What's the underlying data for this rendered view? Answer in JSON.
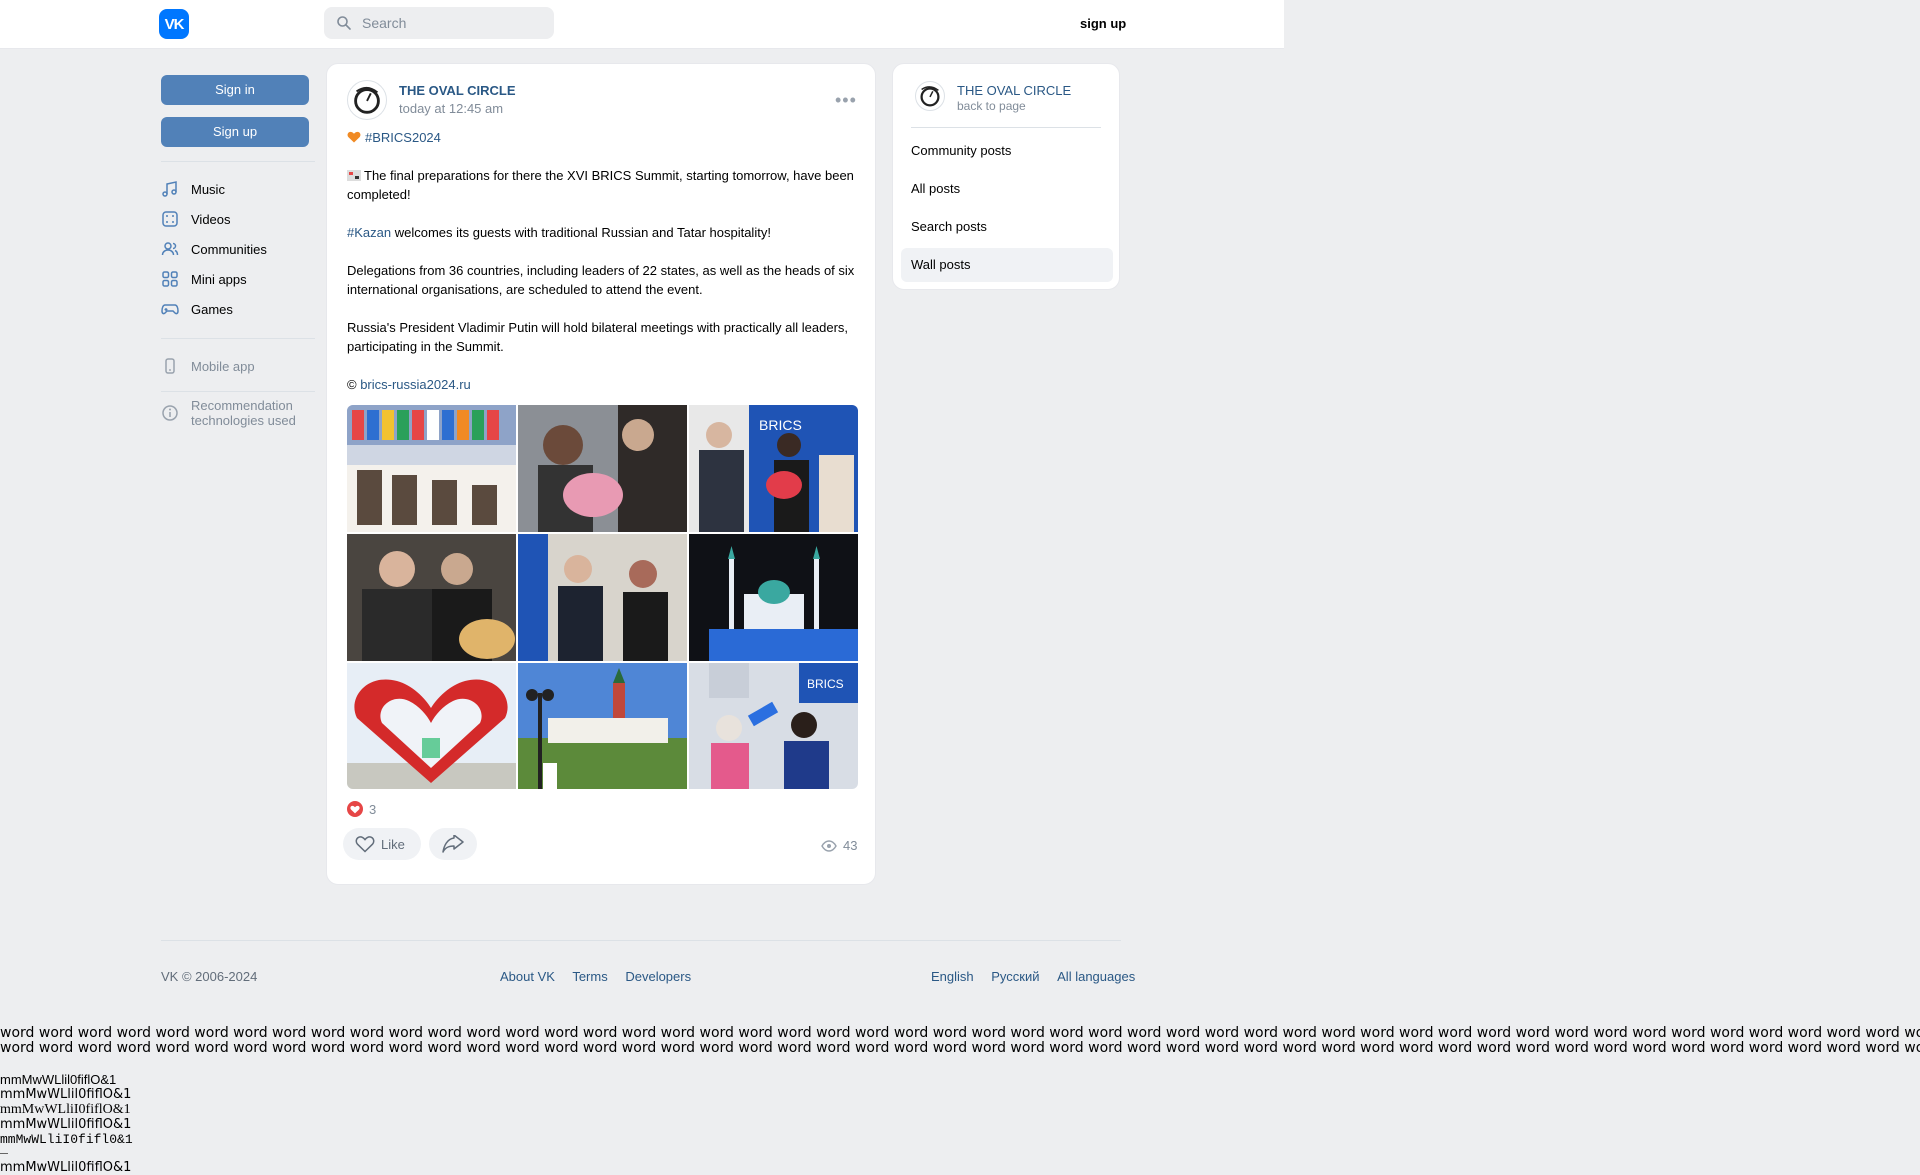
{
  "header": {
    "logo_text": "VK",
    "search_placeholder": "Search",
    "signup_label": "sign up"
  },
  "sidebar": {
    "signin_label": "Sign in",
    "signup_label": "Sign up",
    "items": [
      {
        "label": "Music",
        "icon": "music-icon"
      },
      {
        "label": "Videos",
        "icon": "video-icon"
      },
      {
        "label": "Communities",
        "icon": "communities-icon"
      },
      {
        "label": "Mini apps",
        "icon": "apps-icon"
      },
      {
        "label": "Games",
        "icon": "gamepad-icon"
      }
    ],
    "mobile_app": "Mobile app",
    "recommendation_line1": "Recommendation",
    "recommendation_line2": "technologies used"
  },
  "post": {
    "author": "THE OVAL CIRCLE",
    "date": "today at 12:45 am",
    "hashtag": "#BRICS2024",
    "p1": "The final preparations for there the XVI BRICS Summit, starting tomorrow, have been completed!",
    "kazan_tag": "#Kazan",
    "p2_rest": " welcomes its guests with traditional Russian and Tatar hospitality!",
    "p3": "Delegations from 36 countries, including leaders of 22 states, as well as the heads of six international organisations, are scheduled to attend the event.",
    "p4": "Russia's President Vladimir Putin will hold bilateral meetings with practically all leaders, participating in the Summit.",
    "source_prefix": "© ",
    "source_link": "brics-russia2024.ru",
    "reactions_count": "3",
    "like_label": "Like",
    "views_count": "43"
  },
  "right_panel": {
    "name": "THE OVAL CIRCLE",
    "back": "back to page",
    "items": [
      "Community posts",
      "All posts",
      "Search posts",
      "Wall posts"
    ],
    "active_index": 3
  },
  "footer": {
    "copyright": "VK © 2006-2024",
    "links": [
      "About VK",
      "Terms",
      "Developers"
    ],
    "languages": [
      "English",
      "Русский",
      "All languages"
    ]
  },
  "probe": {
    "words_line1": "word word word word word word word word word word word word word word word word word word word word word word word word word word word word word word word word word word word word word word word word word word word word word word word word word word word word word word word word word word word word word word word word word",
    "words_line2": "word word word word word word word word word word word word word word word word word word word word word word word word word word word word word word word word word word word word word word word word word word word word word word word word word word word word word word word word word word word word word word word word word",
    "lines": [
      "mmMwWLlil0fiflO&1",
      "mmMwWLlil0fiflO&1",
      "mmMwWLliI0fiflO&1",
      "mmMwWLlil0fiflO&1",
      "mmMwWLliI0fifl0&1",
      "mmMwWLlil0fiflO&1"
    ]
  }
}
